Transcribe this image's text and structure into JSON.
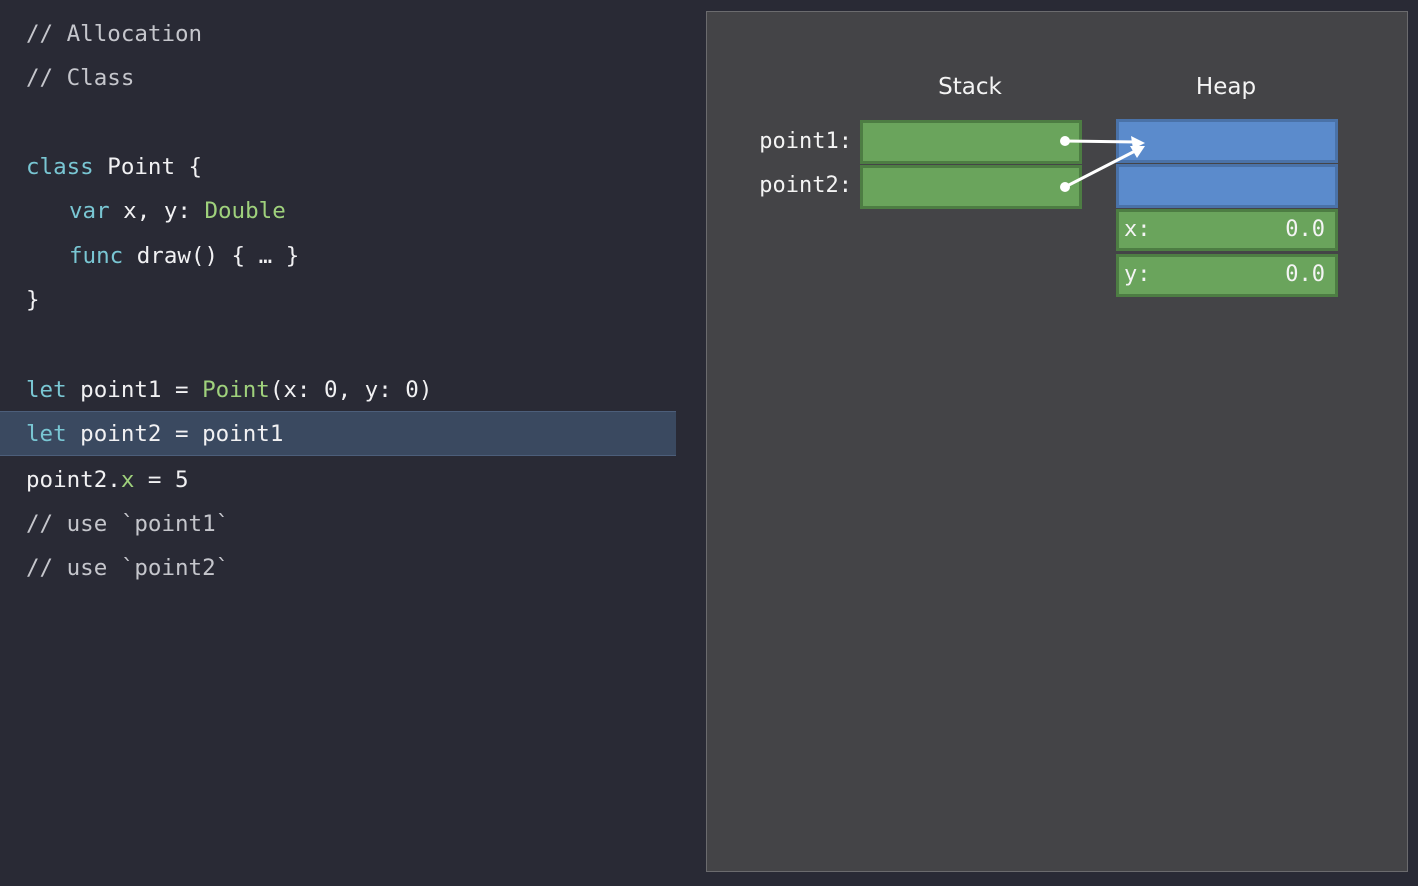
{
  "code": {
    "line1": "// Allocation",
    "line2": "// Class",
    "class_kw": "class",
    "class_rest": " Point {",
    "var_kw": "var",
    "var_mid": " x, y: ",
    "var_type": "Double",
    "func_kw": "func",
    "func_rest": " draw() { … }",
    "close_brace": "}",
    "let1_kw": "let",
    "let1_mid": " point1 = ",
    "let1_type": "Point",
    "let1_rest": "(x: 0, y: 0)",
    "let2_kw": "let",
    "let2_rest": " point2 = point1",
    "assign_pre": "point2.",
    "assign_prop": "x",
    "assign_rest": " = 5",
    "use1": "// use `point1`",
    "use2": "// use `point2`"
  },
  "memory": {
    "stack_header": "Stack",
    "heap_header": "Heap",
    "stack_vars": [
      "point1:",
      "point2:"
    ],
    "heap_fields": [
      {
        "name": "x:",
        "value": "0.0"
      },
      {
        "name": "y:",
        "value": "0.0"
      }
    ]
  },
  "colors": {
    "code_bg": "#292a35",
    "highlight": "#3a4960",
    "panel_bg": "#444447",
    "stack_green": "#6aa45c",
    "heap_blue": "#5b8bcc",
    "keyword": "#79c6d3",
    "type": "#9fd17c",
    "arrow": "#ffffff"
  }
}
